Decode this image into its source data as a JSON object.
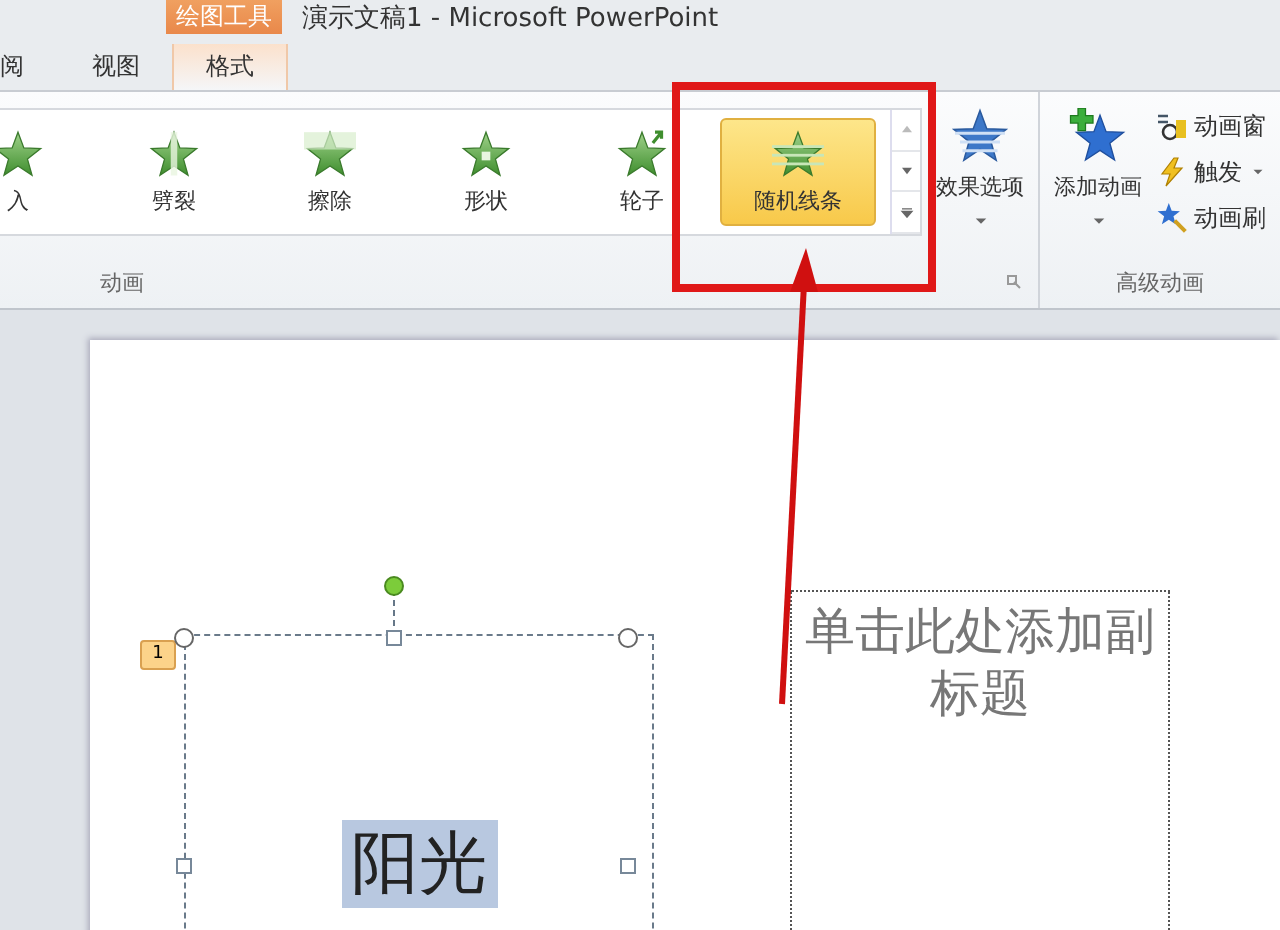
{
  "window": {
    "title": "演示文稿1 - Microsoft PowerPoint"
  },
  "contextual_tab_group": "绘图工具",
  "tabs": [
    {
      "label": "阅",
      "selected": false
    },
    {
      "label": "视图",
      "selected": false
    },
    {
      "label": "格式",
      "selected": true
    }
  ],
  "gallery": {
    "items": [
      {
        "label": "入",
        "kind": "plain",
        "selected": false
      },
      {
        "label": "劈裂",
        "kind": "split",
        "selected": false
      },
      {
        "label": "擦除",
        "kind": "wipe",
        "selected": false
      },
      {
        "label": "形状",
        "kind": "shape",
        "selected": false
      },
      {
        "label": "轮子",
        "kind": "wheel",
        "selected": false
      },
      {
        "label": "随机线条",
        "kind": "bars",
        "selected": true
      }
    ]
  },
  "effect_options": {
    "label": "效果选项"
  },
  "add_animation": {
    "label": "添加动画"
  },
  "advanced_commands": [
    {
      "label": "动画窗",
      "kind": "pane"
    },
    {
      "label": "触发",
      "kind": "trigger"
    },
    {
      "label": "动画刷",
      "kind": "painter"
    }
  ],
  "groups": [
    {
      "label": "动画"
    },
    {
      "label": "高级动画"
    }
  ],
  "slide": {
    "animation_badge": "1",
    "title": "阳光",
    "subtitle": {
      "placeholder": "单击此处添加副标题"
    }
  }
}
